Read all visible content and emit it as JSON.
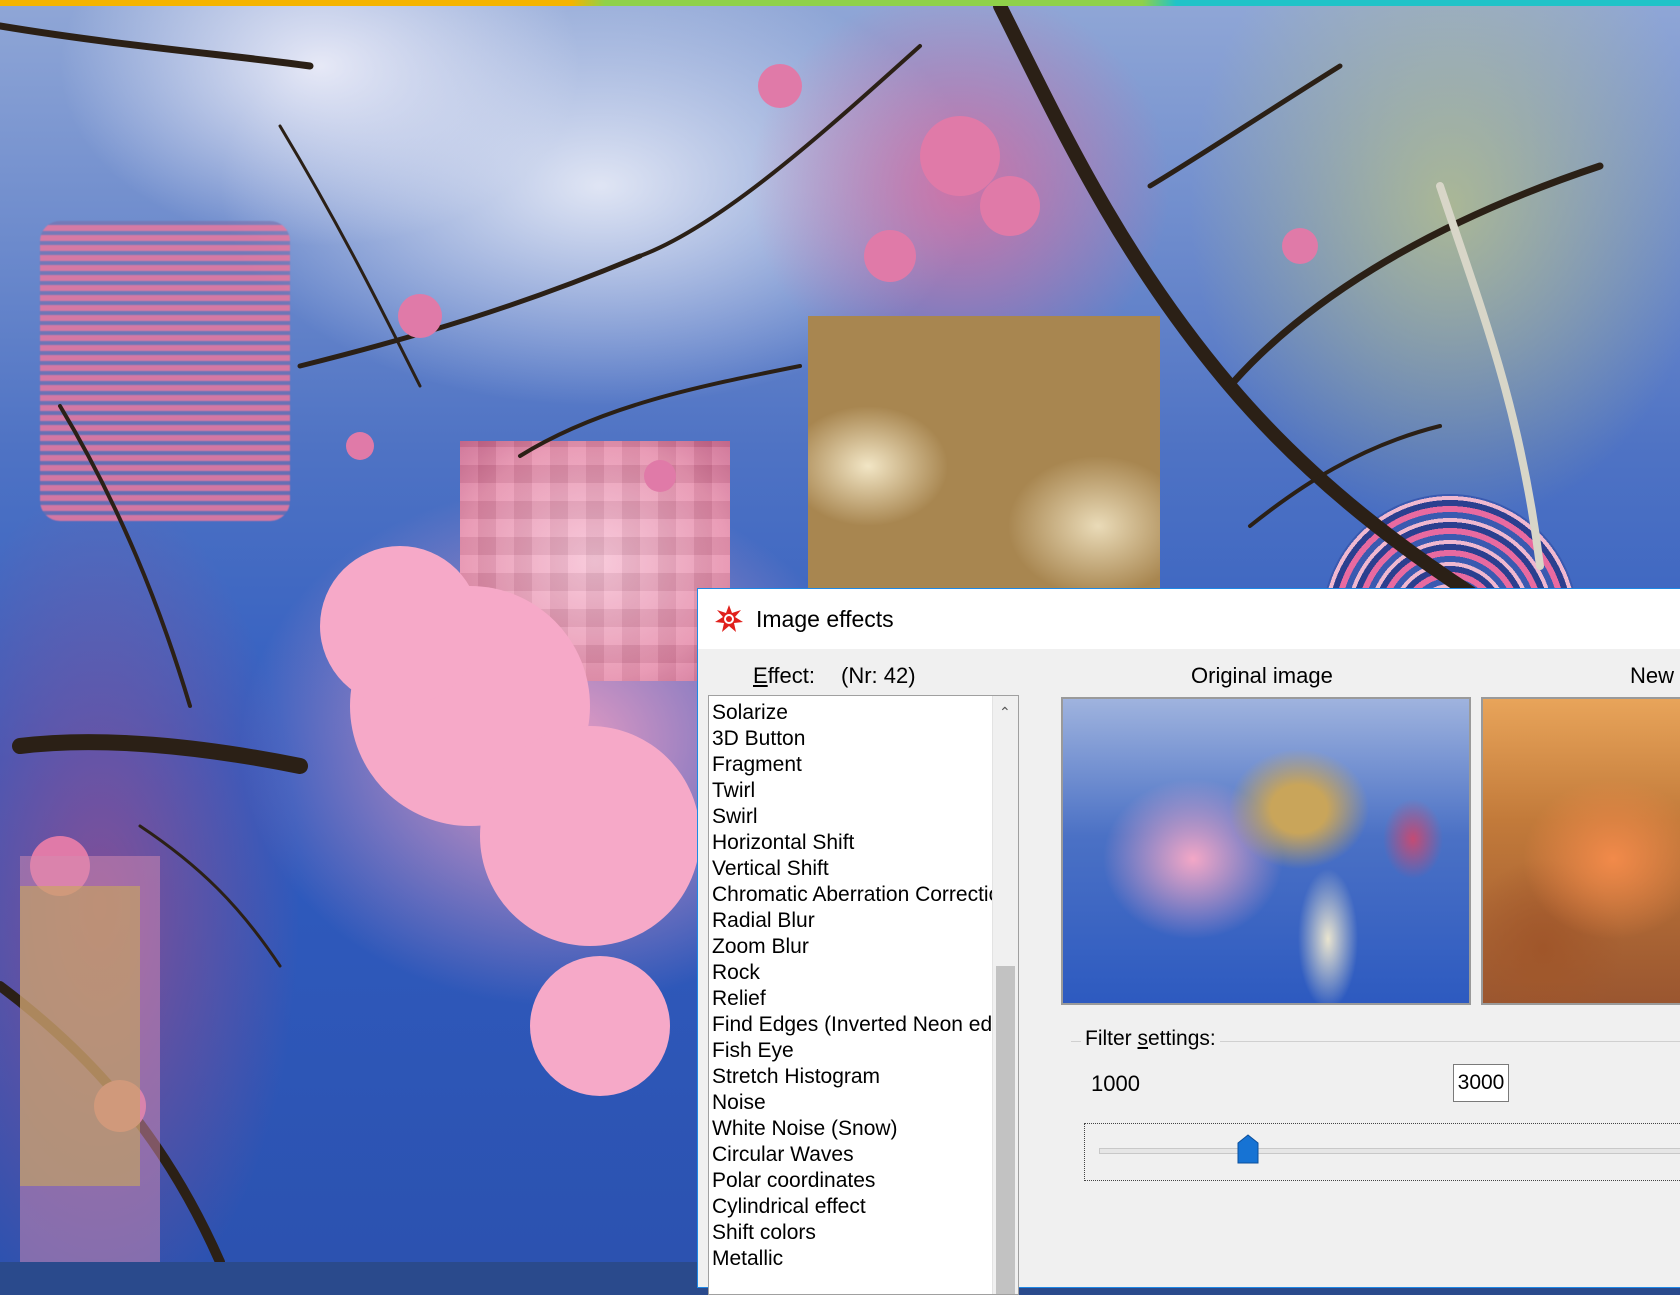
{
  "dialog": {
    "title": "Image effects",
    "effect_label_prefix": "",
    "effect_label_underlined": "E",
    "effect_label_rest": "ffect:",
    "effect_number": "(Nr: 42)",
    "original_label": "Original image",
    "new_label": "New"
  },
  "effects_list": {
    "items": [
      "Solarize",
      "3D Button",
      "Fragment",
      "Twirl",
      "Swirl",
      "Horizontal Shift",
      "Vertical Shift",
      "Chromatic Aberration Correction",
      "Radial Blur",
      "Zoom Blur",
      "Rock",
      "Relief",
      "Find Edges (Inverted Neon edge",
      "Fish Eye",
      "Stretch Histogram",
      "Noise",
      "White Noise (Snow)",
      "Circular Waves",
      "Polar coordinates",
      "Cylindrical effect",
      "Shift colors",
      "Metallic"
    ]
  },
  "filter_settings": {
    "legend_prefix": "Filter ",
    "legend_underlined": "s",
    "legend_rest": "ettings:",
    "min_value": "1000",
    "current_value": "3000",
    "slider_level": 0.24
  },
  "colors": {
    "dialog_border": "#1e88e5",
    "slider_thumb": "#1673d4",
    "app_icon": "#e0201b"
  }
}
